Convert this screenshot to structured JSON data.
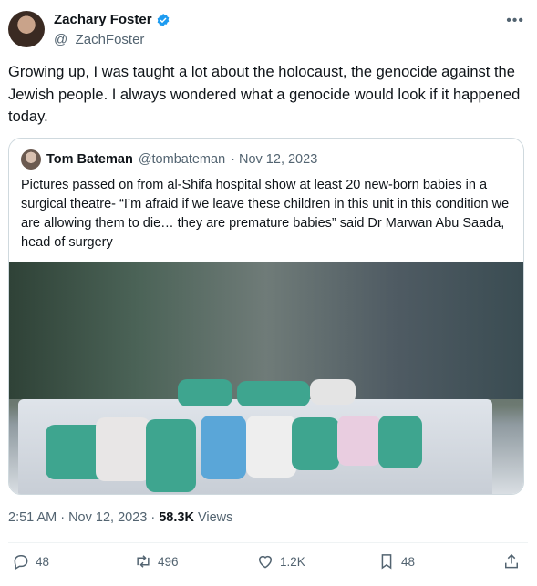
{
  "author": {
    "name": "Zachary Foster",
    "handle": "@_ZachFoster",
    "verified_icon": "verified-badge-icon"
  },
  "more_icon": "more-horizontal-icon",
  "tweet": {
    "text": "Growing up, I was taught a lot about the holocaust, the genocide against the Jewish people. I always wondered what a genocide would look if it happened today."
  },
  "quote": {
    "name": "Tom Bateman",
    "handle": "@tombateman",
    "date": "· Nov 12, 2023",
    "text": "Pictures passed on from al-Shifa hospital show at least 20 new-born babies in a surgical theatre- “I’m afraid if we leave these children in this unit in this condition we are allowing them to die… they are premature babies” said Dr Marwan Abu Saada, head of surgery"
  },
  "meta": {
    "time": "2:51 AM · Nov 12, 2023 · ",
    "views_count": "58.3K",
    "views_label": " Views"
  },
  "actions": {
    "replies": "48",
    "reposts": "496",
    "likes": "1.2K",
    "bookmarks": "48"
  },
  "colors": {
    "accent": "#1d9bf0",
    "muted": "#536471",
    "text": "#0f1419",
    "border": "#cfd9de"
  }
}
